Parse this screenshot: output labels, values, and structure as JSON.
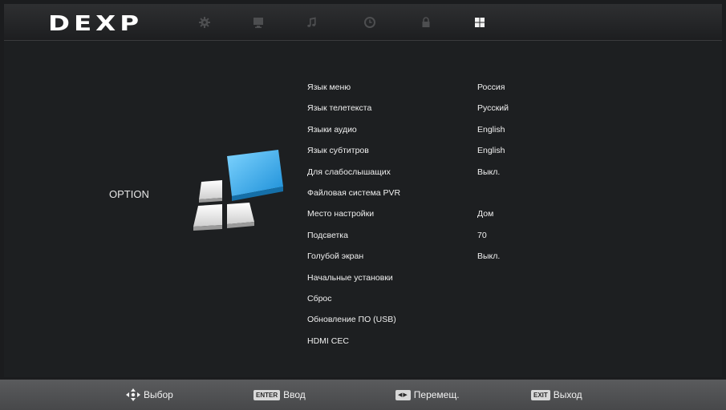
{
  "header": {
    "logo": "DEXP",
    "tabs": [
      {
        "name": "settings-tab-icon",
        "icon": "gear-icon",
        "active": false
      },
      {
        "name": "picture-tab-icon",
        "icon": "monitor-icon",
        "active": false
      },
      {
        "name": "sound-tab-icon",
        "icon": "music-note-icon",
        "active": false
      },
      {
        "name": "time-tab-icon",
        "icon": "clock-icon",
        "active": false
      },
      {
        "name": "lock-tab-icon",
        "icon": "lock-icon",
        "active": false
      },
      {
        "name": "option-tab-icon",
        "icon": "grid-icon",
        "active": true
      }
    ]
  },
  "page": {
    "title": "OPTION"
  },
  "menu": {
    "items": [
      {
        "label": "Язык меню",
        "value": "Россия"
      },
      {
        "label": "Язык телетекста",
        "value": "Русский"
      },
      {
        "label": "Языки аудио",
        "value": "English"
      },
      {
        "label": "Язык субтитров",
        "value": "English"
      },
      {
        "label": "Для слабослышащих",
        "value": "Выкл."
      },
      {
        "label": "Файловая система PVR",
        "value": ""
      },
      {
        "label": "Место настройки",
        "value": "Дом"
      },
      {
        "label": "Подсветка",
        "value": "70"
      },
      {
        "label": "Голубой экран",
        "value": "Выкл."
      },
      {
        "label": "Начальные установки",
        "value": ""
      },
      {
        "label": "Сброс",
        "value": ""
      },
      {
        "label": "Обновление ПО (USB)",
        "value": ""
      },
      {
        "label": "HDMI CEC",
        "value": ""
      }
    ]
  },
  "footer": {
    "select_label": "Выбор",
    "enter_key": "ENTER",
    "enter_label": "Ввод",
    "move_label": "Перемещ.",
    "exit_key": "EXIT",
    "exit_label": "Выход"
  },
  "colors": {
    "accent": "#2aa0e0",
    "background": "#1d1f21",
    "bottom_bar": "#505153"
  }
}
